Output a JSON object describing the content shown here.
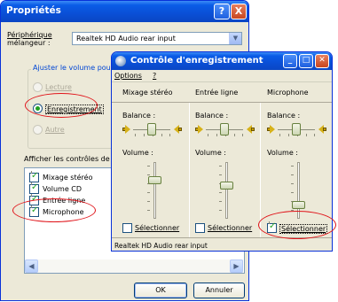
{
  "properties_window": {
    "title": "Propriétés",
    "help_button": "?",
    "close_button": "X",
    "mixer_label_line1": "Périphérique",
    "mixer_label_line2": "mélangeur :",
    "mixer_value": "Realtek HD Audio rear input",
    "adjust_group_title": "Ajuster le volume pour",
    "radio_playback": "Lecture",
    "radio_recording": "Enregistrement",
    "radio_other": "Autre",
    "show_controls_label": "Afficher les contrôles de vol",
    "controls": [
      {
        "label": "Mixage stéréo",
        "checked": true
      },
      {
        "label": "Volume CD",
        "checked": true
      },
      {
        "label": "Entrée ligne",
        "checked": true
      },
      {
        "label": "Microphone",
        "checked": true
      }
    ],
    "ok_button": "OK",
    "cancel_button": "Annuler"
  },
  "recording_window": {
    "title": "Contrôle d'enregistrement",
    "menu": [
      "Options",
      "?"
    ],
    "channels": [
      {
        "name": "Mixage stéréo",
        "balance_label": "Balance :",
        "volume_label": "Volume :",
        "select_label": "Sélectionner",
        "selected": false
      },
      {
        "name": "Entrée ligne",
        "balance_label": "Balance :",
        "volume_label": "Volume :",
        "select_label": "Sélectionner",
        "selected": false
      },
      {
        "name": "Microphone",
        "balance_label": "Balance :",
        "volume_label": "Volume :",
        "select_label": "Sélectionner",
        "selected": true
      }
    ],
    "status": "Realtek HD Audio rear input"
  },
  "colors": {
    "titlebar": "#0a4fd6",
    "highlight_ring": "#e0141a",
    "check": "#21a121"
  }
}
